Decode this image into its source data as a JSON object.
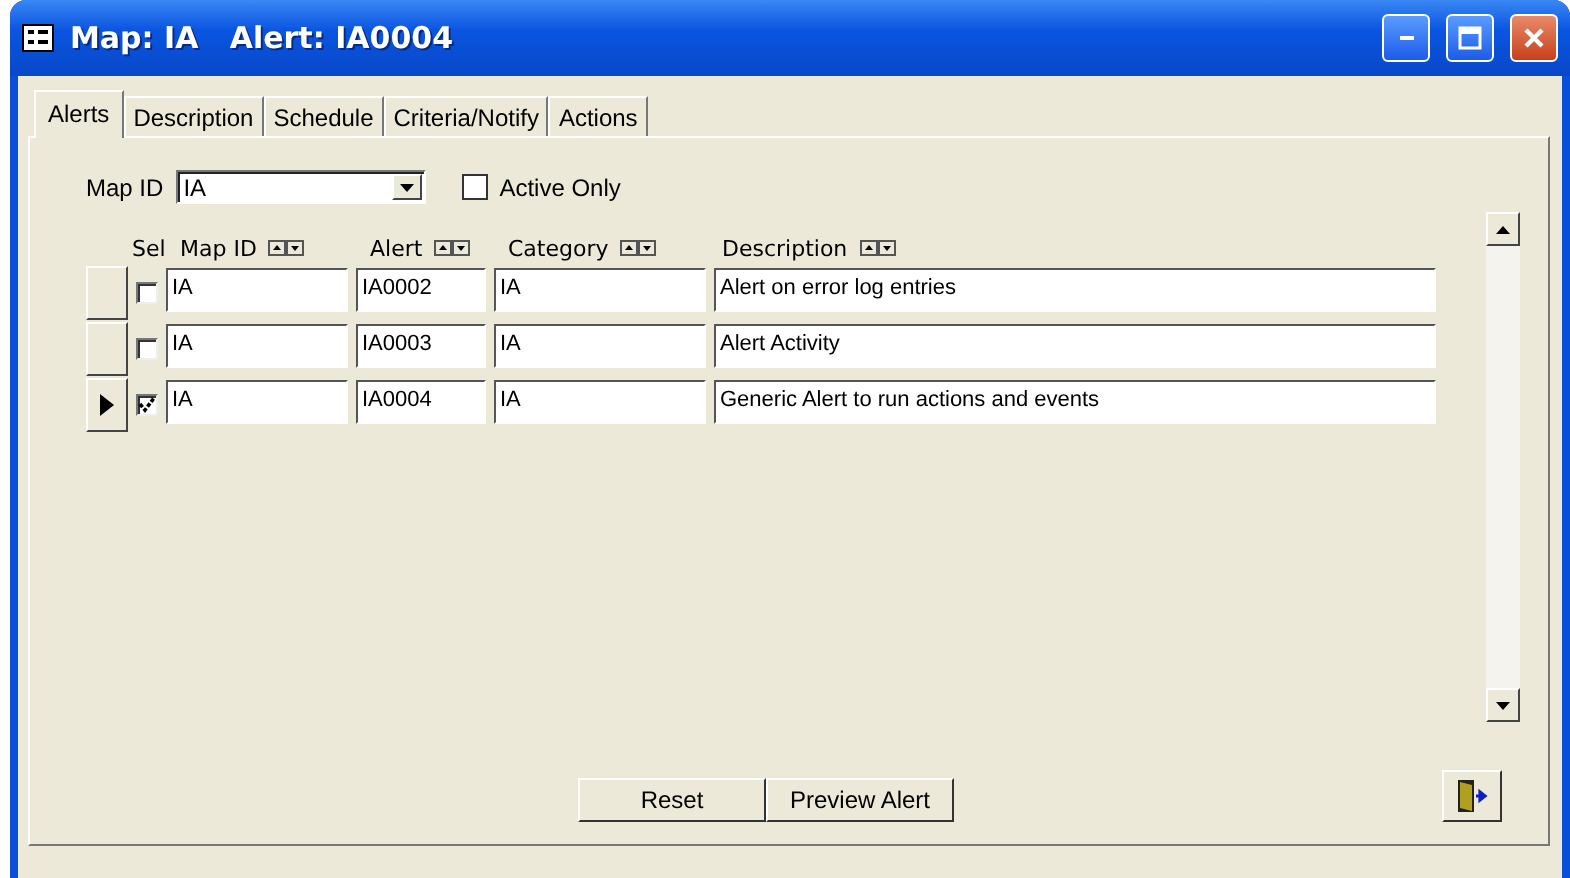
{
  "window": {
    "title": "Map: IA   Alert: IA0004"
  },
  "tabs": [
    {
      "label": "Alerts",
      "selected": true
    },
    {
      "label": "Description",
      "selected": false
    },
    {
      "label": "Schedule",
      "selected": false
    },
    {
      "label": "Criteria/Notify",
      "selected": false
    },
    {
      "label": "Actions",
      "selected": false
    }
  ],
  "filter": {
    "map_id_label": "Map ID",
    "map_id_value": "IA",
    "active_only": {
      "label": "Active Only",
      "checked": false
    }
  },
  "table": {
    "columns": [
      {
        "label": "Sel",
        "sortable": false
      },
      {
        "label": "Map ID",
        "sortable": true
      },
      {
        "label": "Alert",
        "sortable": true
      },
      {
        "label": "Category",
        "sortable": true
      },
      {
        "label": "Description",
        "sortable": true
      }
    ],
    "rows": [
      {
        "selected": false,
        "current": false,
        "map_id": "IA",
        "alert": "IA0002",
        "category": "IA",
        "description": "Alert on  error log entries"
      },
      {
        "selected": false,
        "current": false,
        "map_id": "IA",
        "alert": "IA0003",
        "category": "IA",
        "description": "Alert Activity"
      },
      {
        "selected": true,
        "current": true,
        "map_id": "IA",
        "alert": "IA0004",
        "category": "IA",
        "description": "Generic Alert to run actions and events"
      }
    ]
  },
  "buttons": [
    {
      "label": "Reset"
    },
    {
      "label": "Preview Alert"
    }
  ]
}
